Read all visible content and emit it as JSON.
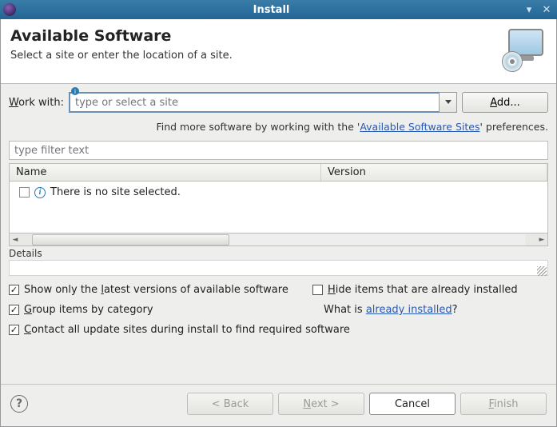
{
  "window": {
    "title": "Install"
  },
  "header": {
    "title": "Available Software",
    "subtitle": "Select a site or enter the location of a site."
  },
  "workwith": {
    "label_pre": "W",
    "label_post": "ork with:",
    "placeholder": "type or select a site",
    "add_pre": "A",
    "add_post": "dd..."
  },
  "hint": {
    "pre": "Find more software by working with the '",
    "link": "Available Software Sites",
    "post": "' preferences."
  },
  "filter": {
    "placeholder": "type filter text"
  },
  "table": {
    "col_name": "Name",
    "col_version": "Version",
    "row_text": "There is no site selected."
  },
  "details": {
    "label": "Details"
  },
  "checks": {
    "latest_pre": "Show only the ",
    "latest_u": "l",
    "latest_post": "atest versions of available software",
    "hide_u": "H",
    "hide_post": "ide items that are already installed",
    "group_u": "G",
    "group_post": "roup items by category",
    "contact_u": "C",
    "contact_post": "ontact all update sites during install to find required software",
    "already_pre": "What is ",
    "already_link": "already installed",
    "already_post": "?"
  },
  "footer": {
    "back": "< Back",
    "next_u": "N",
    "next_post": "ext >",
    "cancel": "Cancel",
    "finish_u": "F",
    "finish_post": "inish"
  }
}
